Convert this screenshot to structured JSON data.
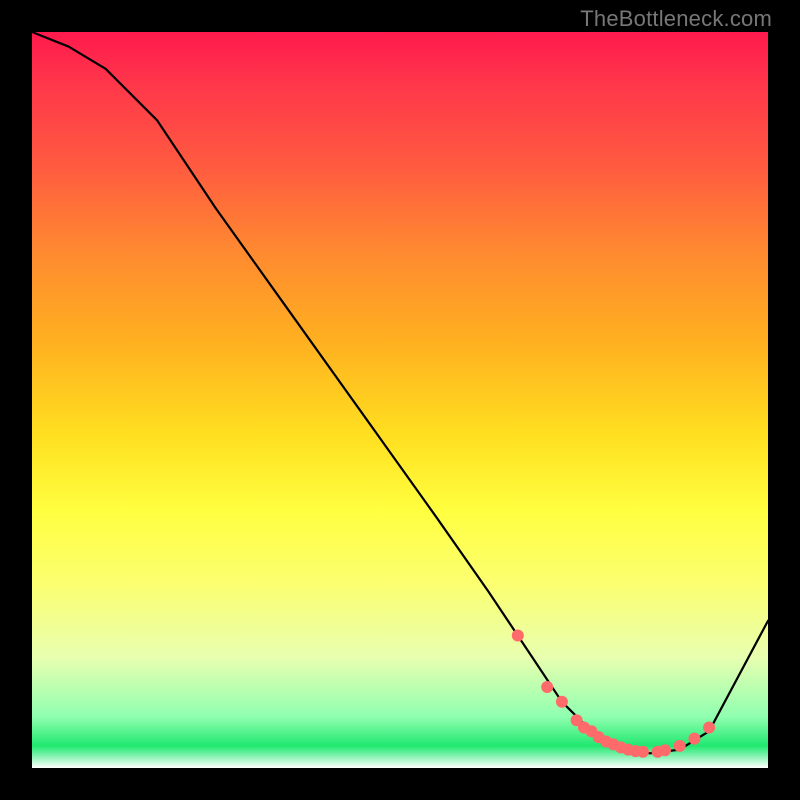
{
  "watermark": "TheBottleneck.com",
  "chart_data": {
    "type": "line",
    "title": "",
    "xlabel": "",
    "ylabel": "",
    "xlim": [
      0,
      100
    ],
    "ylim": [
      0,
      100
    ],
    "grid": false,
    "annotations": [],
    "series": [
      {
        "name": "curve",
        "type": "line",
        "color": "#000000",
        "x": [
          0,
          5,
          10,
          17,
          25,
          35,
          45,
          55,
          62,
          68,
          72,
          76,
          80,
          84,
          88,
          92,
          100
        ],
        "y": [
          100,
          98,
          95,
          88,
          76,
          62,
          48,
          34,
          24,
          15,
          9,
          5,
          2.5,
          2,
          2.5,
          5,
          20
        ]
      },
      {
        "name": "highlight-dots",
        "type": "scatter",
        "color": "#ff6a6a",
        "x": [
          66,
          70,
          72,
          74,
          75,
          76,
          77,
          78,
          79,
          80,
          81,
          82,
          83,
          85,
          86,
          88,
          90,
          92
        ],
        "y": [
          18,
          11,
          9,
          6.5,
          5.5,
          5,
          4.2,
          3.6,
          3.2,
          2.8,
          2.5,
          2.3,
          2.2,
          2.2,
          2.4,
          3,
          4,
          5.5
        ]
      }
    ]
  }
}
